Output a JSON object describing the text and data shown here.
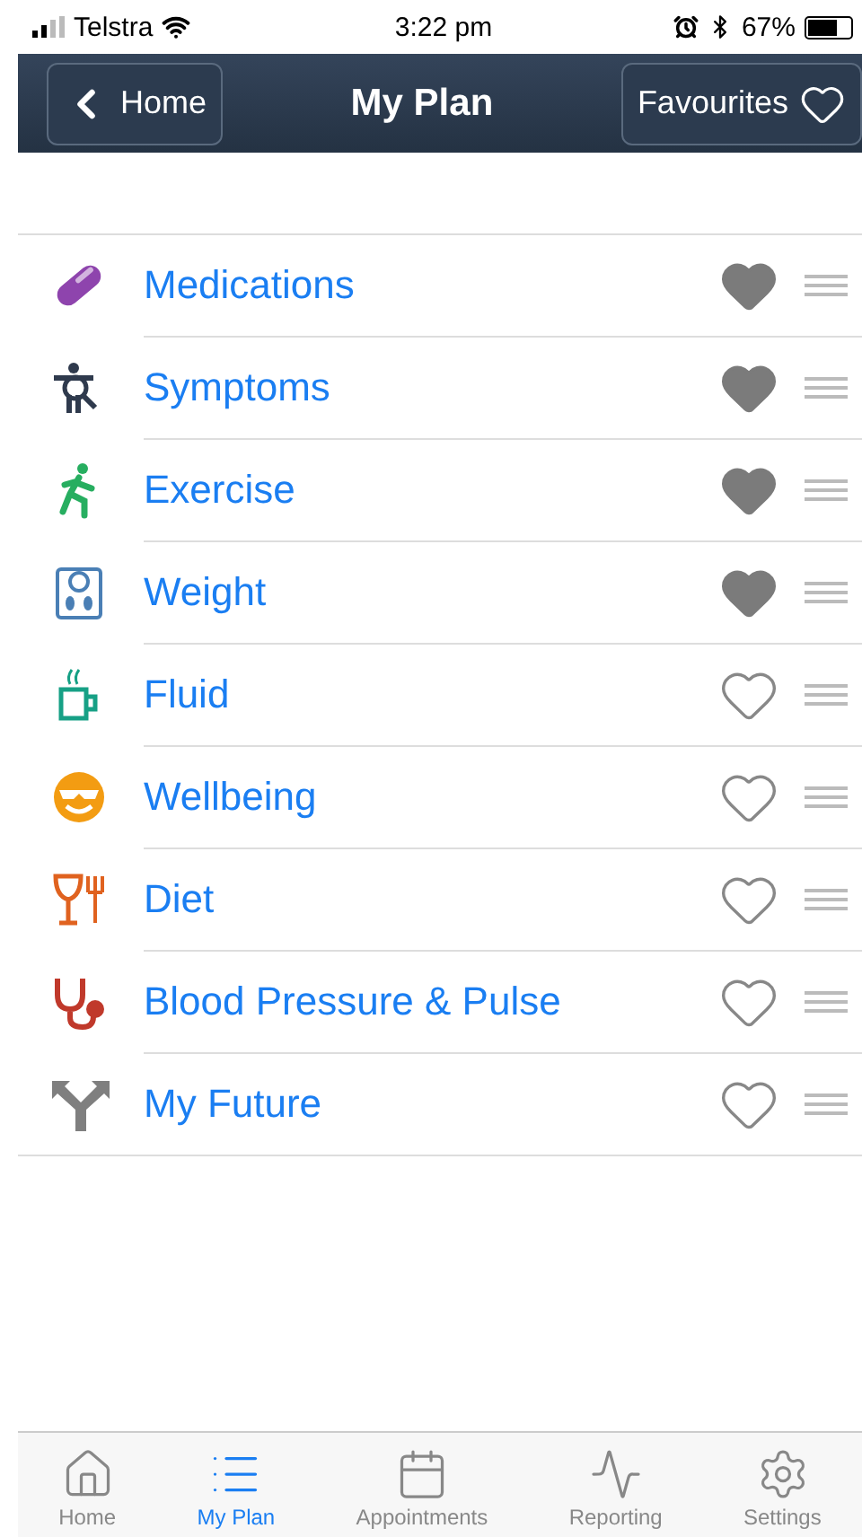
{
  "status_bar": {
    "carrier": "Telstra",
    "time": "3:22 pm",
    "battery": "67%"
  },
  "nav_bar": {
    "back": "Home",
    "title": "My Plan",
    "favourites": "Favourites"
  },
  "items": [
    {
      "label": "Medications",
      "kind": "pill",
      "color": "#8e44ad",
      "favourite": true
    },
    {
      "label": "Symptoms",
      "kind": "body",
      "color": "#2f3a4d",
      "favourite": true
    },
    {
      "label": "Exercise",
      "kind": "runner",
      "color": "#27ae60",
      "favourite": true
    },
    {
      "label": "Weight",
      "kind": "scale",
      "color": "#4a7fb5",
      "favourite": true
    },
    {
      "label": "Fluid",
      "kind": "cup",
      "color": "#16a085",
      "favourite": false
    },
    {
      "label": "Wellbeing",
      "kind": "smiley",
      "color": "#f39c12",
      "favourite": false
    },
    {
      "label": "Diet",
      "kind": "cutlery",
      "color": "#e0621f",
      "favourite": false
    },
    {
      "label": "Blood Pressure & Pulse",
      "kind": "stethoscope",
      "color": "#c0392b",
      "favourite": false
    },
    {
      "label": "My Future",
      "kind": "fork",
      "color": "#7f7f7f",
      "favourite": false
    }
  ],
  "tabs": [
    {
      "label": "Home",
      "kind": "home",
      "selected": false
    },
    {
      "label": "My Plan",
      "kind": "list",
      "selected": true
    },
    {
      "label": "Appointments",
      "kind": "calendar",
      "selected": false
    },
    {
      "label": "Reporting",
      "kind": "pulse",
      "selected": false
    },
    {
      "label": "Settings",
      "kind": "gear",
      "selected": false
    }
  ]
}
